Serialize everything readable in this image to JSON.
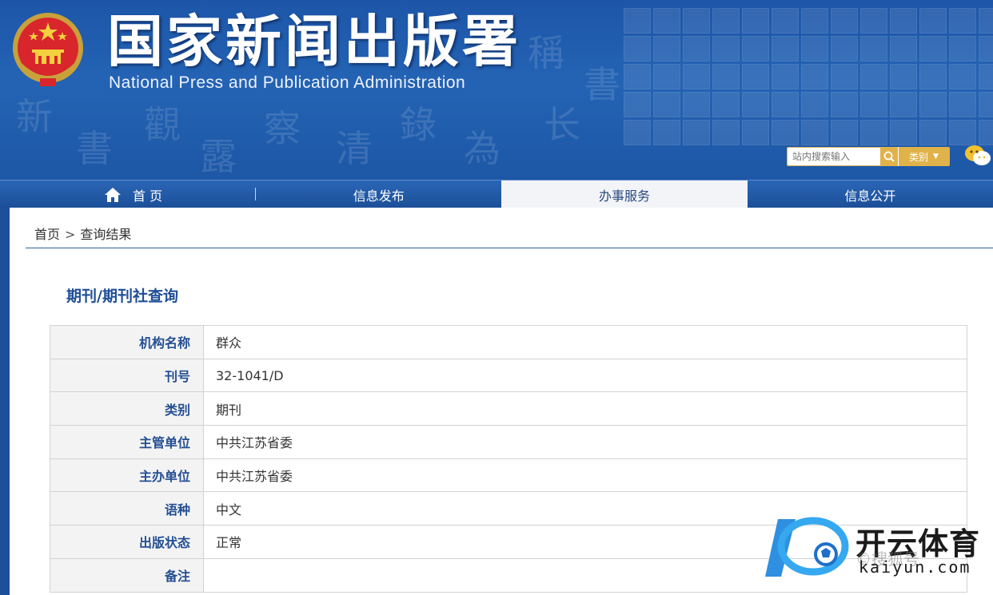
{
  "header": {
    "title_cn": "国家新闻出版署",
    "title_en": "National  Press and Publication Administration",
    "search_placeholder": "站内搜索输入",
    "category_label": "类别"
  },
  "nav": {
    "items": [
      {
        "label": "首 页"
      },
      {
        "label": "信息发布"
      },
      {
        "label": "办事服务"
      },
      {
        "label": "信息公开"
      }
    ]
  },
  "breadcrumb": {
    "home": "首页",
    "separator": ">",
    "current": "查询结果"
  },
  "section_title": "期刊/期刊社查询",
  "table": {
    "rows": [
      {
        "label": "机构名称",
        "value": "群众"
      },
      {
        "label": "刊号",
        "value": "32-1041/D"
      },
      {
        "label": "类别",
        "value": "期刊"
      },
      {
        "label": "主管单位",
        "value": "中共江苏省委"
      },
      {
        "label": "主办单位",
        "value": "中共江苏省委"
      },
      {
        "label": "语种",
        "value": "中文"
      },
      {
        "label": "出版状态",
        "value": "正常"
      },
      {
        "label": "备注",
        "value": ""
      }
    ]
  },
  "watermark": {
    "brand": "开云体育",
    "faint": "©搜狐号",
    "url": "kaiyun.com"
  },
  "colors": {
    "banner_blue": "#1d56a8",
    "label_blue": "#244f93",
    "accent_gold": "#e0b24a"
  }
}
